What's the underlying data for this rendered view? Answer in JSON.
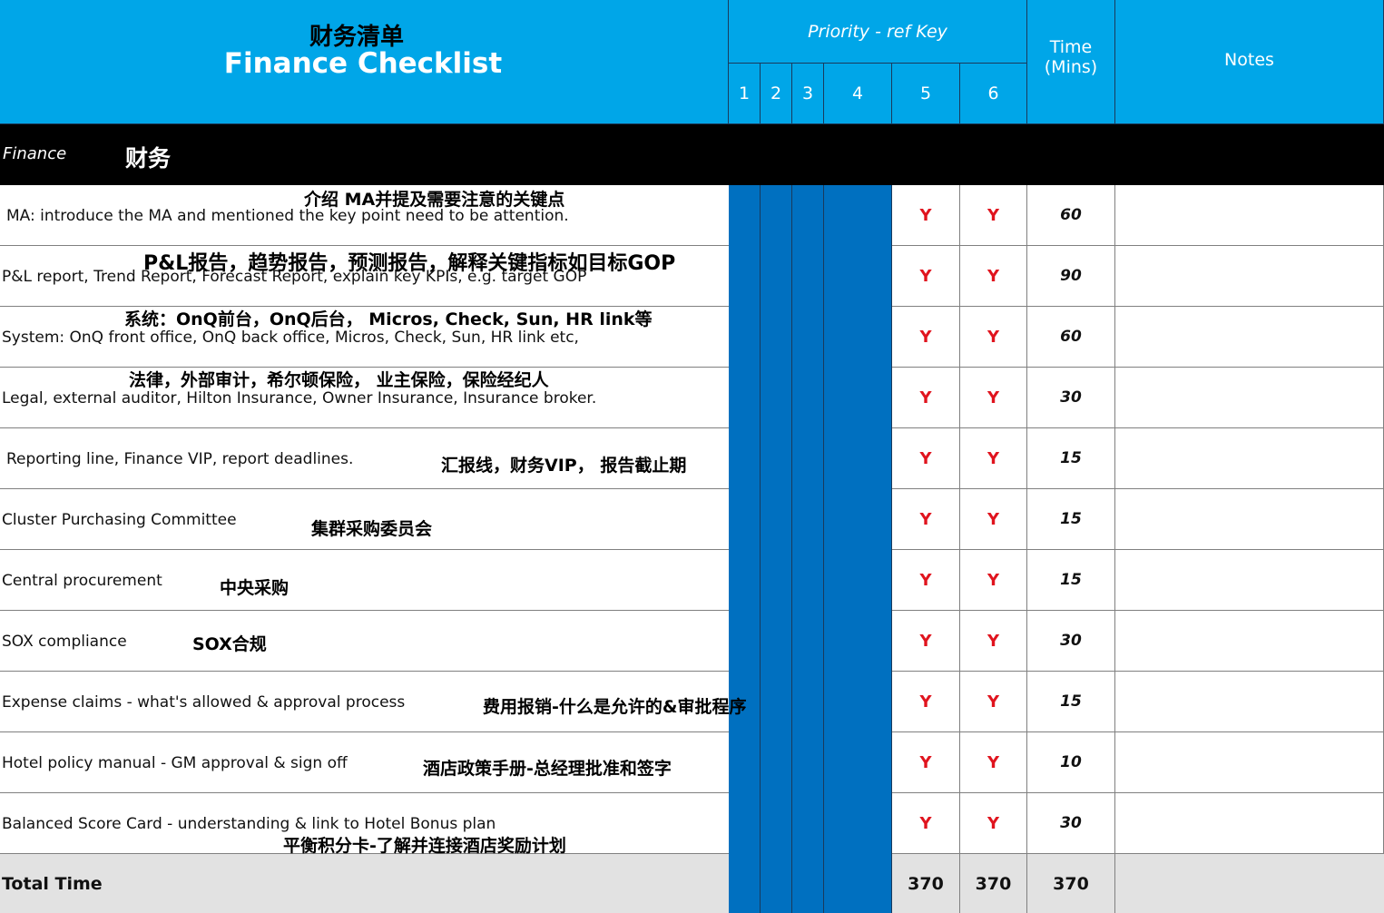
{
  "header": {
    "title_zh": "财务清单",
    "title_en": "Finance Checklist",
    "priority_label": "Priority - ref Key",
    "priority_keys": [
      "1",
      "2",
      "3",
      "4",
      "5",
      "6"
    ],
    "time_label_1": "Time",
    "time_label_2": "(Mins)",
    "notes_label": "Notes"
  },
  "section": {
    "en": "Finance",
    "zh": "财务"
  },
  "rows": [
    {
      "en": "MA: introduce the MA and mentioned the key point need to be attention.",
      "zh": "介绍 MA并提及需要注意的关键点",
      "p5": "Y",
      "p6": "Y",
      "time": "60"
    },
    {
      "en": "P&L report, Trend Report, Forecast Report, explain key KPIs, e.g. target GOP",
      "zh": "P&L报告，趋势报告，预测报告，解释关键指标如目标GOP",
      "p5": "Y",
      "p6": "Y",
      "time": "90"
    },
    {
      "en": "System: OnQ front office, OnQ back office, Micros, Check, Sun, HR link etc,",
      "zh": "系统：OnQ前台，OnQ后台， Micros, Check, Sun, HR link等",
      "p5": "Y",
      "p6": "Y",
      "time": "60"
    },
    {
      "en": "Legal, external auditor, Hilton Insurance, Owner Insurance, Insurance broker.",
      "zh": "法律，外部审计，希尔顿保险， 业主保险，保险经纪人",
      "p5": "Y",
      "p6": "Y",
      "time": "30"
    },
    {
      "en": "Reporting line, Finance VIP, report  deadlines.",
      "zh": "汇报线，财务VIP， 报告截止期",
      "p5": "Y",
      "p6": "Y",
      "time": "15"
    },
    {
      "en": "Cluster Purchasing Committee",
      "zh": "集群采购委员会",
      "p5": "Y",
      "p6": "Y",
      "time": "15"
    },
    {
      "en": "Central procurement",
      "zh": "中央采购",
      "p5": "Y",
      "p6": "Y",
      "time": "15"
    },
    {
      "en": "SOX compliance",
      "zh": "SOX合规",
      "p5": "Y",
      "p6": "Y",
      "time": "30"
    },
    {
      "en": "Expense claims - what's allowed & approval process",
      "zh": "费用报销-什么是允许的&审批程序",
      "p5": "Y",
      "p6": "Y",
      "time": "15"
    },
    {
      "en": "Hotel policy manual - GM approval & sign off",
      "zh": "酒店政策手册-总经理批准和签字",
      "p5": "Y",
      "p6": "Y",
      "time": "10"
    },
    {
      "en": "Balanced Score Card - understanding & link to Hotel Bonus plan",
      "zh": "平衡积分卡-了解并连接酒店奖励计划",
      "p5": "Y",
      "p6": "Y",
      "time": "30"
    }
  ],
  "total": {
    "label": "Total Time",
    "p5": "370",
    "p6": "370",
    "time": "370"
  },
  "colors": {
    "header_blue": "#00a6e8",
    "priority_blue": "#0070c0",
    "section_black": "#000000",
    "total_gray": "#e2e2e2",
    "flag_red": "#e0141e"
  }
}
